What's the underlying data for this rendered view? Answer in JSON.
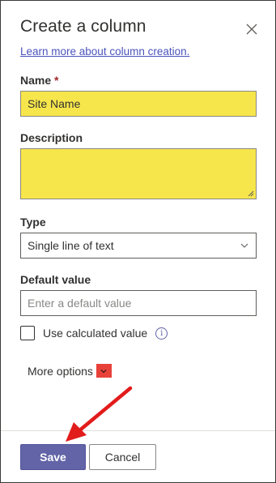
{
  "panel": {
    "title": "Create a column",
    "learn_more_link": "Learn more about column creation."
  },
  "name": {
    "label": "Name",
    "required_mark": "*",
    "value": "Site Name"
  },
  "description": {
    "label": "Description",
    "value": ""
  },
  "type": {
    "label": "Type",
    "selected": "Single line of text"
  },
  "default_value": {
    "label": "Default value",
    "placeholder": "Enter a default value"
  },
  "calculated": {
    "label": "Use calculated value",
    "checked": false
  },
  "more_options": {
    "label": "More options"
  },
  "footer": {
    "save_label": "Save",
    "cancel_label": "Cancel"
  },
  "colors": {
    "accent": "#6264a7",
    "highlight_yellow": "#f6e64b",
    "annotation_red": "#e8413a"
  },
  "icons": {
    "close": "close-icon",
    "dropdown": "chevron-down-icon",
    "info": "info-icon",
    "annotation": "red-arrow-annotation"
  }
}
